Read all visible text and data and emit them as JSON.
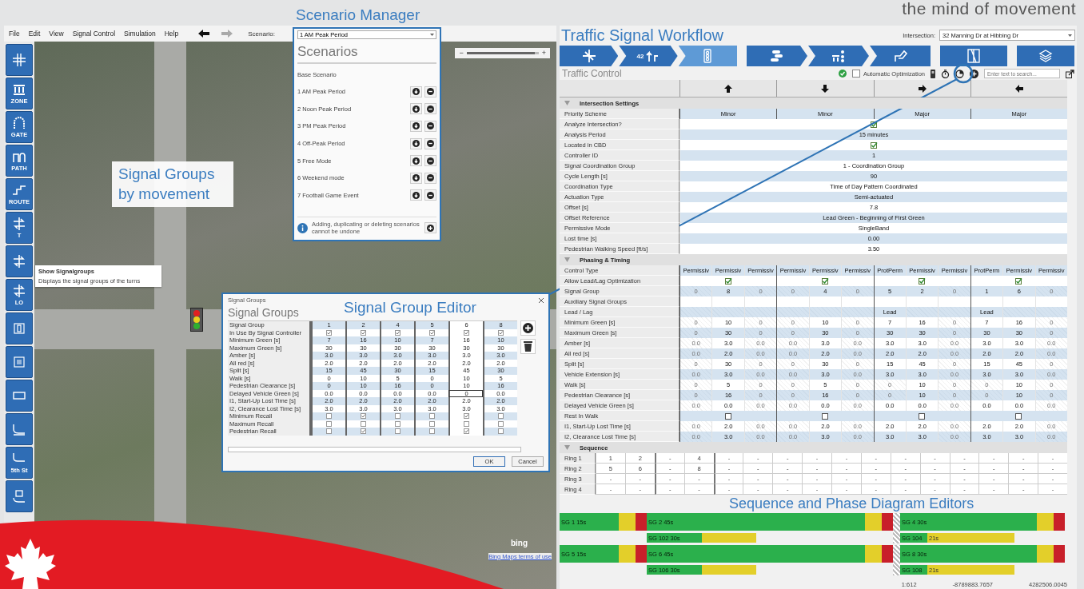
{
  "header": {
    "tagline": "the mind of movement"
  },
  "callouts": {
    "scenario_manager": "Scenario Manager",
    "workflow": "Traffic Signal Workflow",
    "signal_groups": "Signal Groups by movement",
    "editor": "Signal Group Editor",
    "sequence": "Sequence and Phase Diagram Editors"
  },
  "menu": {
    "items": [
      "File",
      "Edit",
      "View",
      "Signal Control",
      "Simulation",
      "Help"
    ],
    "nav": [
      {
        "kind": "back",
        "disabled": false
      },
      {
        "kind": "forward",
        "disabled": true
      }
    ],
    "scenario_label": "Scenario:"
  },
  "toolbar": {
    "buttons": [
      {
        "kind": "intersection"
      },
      {
        "kind": "zone",
        "label": "ZONE"
      },
      {
        "kind": "gate",
        "label": "GATE"
      },
      {
        "kind": "path",
        "label": "PATH"
      },
      {
        "kind": "route",
        "label": "ROUTE"
      },
      {
        "kind": "turns",
        "label": "T"
      },
      {
        "kind": "turns"
      },
      {
        "kind": "turns",
        "label": "LO"
      },
      {
        "kind": "signal"
      },
      {
        "kind": "detector"
      },
      {
        "kind": "sign"
      },
      {
        "kind": "road"
      },
      {
        "kind": "street",
        "label": "5th St"
      },
      {
        "kind": "lane"
      }
    ]
  },
  "map": {
    "zoom": {
      "out": "−",
      "in": "+",
      "level": 0.95
    },
    "tooltip": {
      "title": "Show Signalgroups",
      "text": "Displays the signal groups of the turns"
    },
    "logo": "bing",
    "attribution": "Bing Maps terms of use"
  },
  "scenarios": {
    "current": "1 AM Peak Period",
    "title": "Scenarios",
    "base": "Base Scenario",
    "items": [
      "1 AM Peak Period",
      "2 Noon Peak Period",
      "3 PM Peak Period",
      "4 Off-Peak Period",
      "5 Free Mode",
      "6 Weekend mode",
      "7 Football Game Event"
    ],
    "note": "Adding, duplicating or deleting scenarios cannot be undone"
  },
  "editor": {
    "window_title": "Signal Groups",
    "heading": "Signal Groups",
    "header_label": "Signal Group",
    "columns": [
      {
        "label": "1",
        "selected": false
      },
      {
        "label": "2",
        "selected": false
      },
      {
        "label": "4",
        "selected": false
      },
      {
        "label": "5",
        "selected": false
      },
      {
        "label": "6",
        "selected": true
      },
      {
        "label": "8",
        "selected": false
      }
    ],
    "rows": [
      {
        "label": "In Use By Signal Controller",
        "kind": "check",
        "cells": [
          {
            "checked": true
          },
          {
            "checked": true
          },
          {
            "checked": true
          },
          {
            "checked": true
          },
          {
            "checked": true
          },
          {
            "checked": true
          }
        ]
      },
      {
        "label": "Minimum Green [s]",
        "kind": "text",
        "cells": [
          "7",
          "16",
          "10",
          "7",
          "16",
          "10"
        ]
      },
      {
        "label": "Maximum Green [s]",
        "kind": "text",
        "cells": [
          "30",
          "30",
          "30",
          "30",
          "30",
          "30"
        ]
      },
      {
        "label": "Amber [s]",
        "kind": "text",
        "cells": [
          "3.0",
          "3.0",
          "3.0",
          "3.0",
          "3.0",
          "3.0"
        ]
      },
      {
        "label": "All red [s]",
        "kind": "text",
        "cells": [
          "2.0",
          "2.0",
          "2.0",
          "2.0",
          "2.0",
          "2.0"
        ]
      },
      {
        "label": "Split [s]",
        "kind": "text",
        "cells": [
          "15",
          "45",
          "30",
          "15",
          "45",
          "30"
        ]
      },
      {
        "label": "Walk [s]",
        "kind": "text",
        "cells": [
          "0",
          "10",
          "5",
          "0",
          "10",
          "5"
        ]
      },
      {
        "label": "Pedestrian Clearance [s]",
        "kind": "text",
        "cells": [
          "0",
          "10",
          "16",
          "0",
          "10",
          "16"
        ]
      },
      {
        "label": "Delayed Vehicle Green [s]",
        "kind": "edit",
        "cells": [
          {
            "text": "0.0",
            "editing": false
          },
          {
            "text": "0.0",
            "editing": false
          },
          {
            "text": "0.0",
            "editing": false
          },
          {
            "text": "0.0",
            "editing": false
          },
          {
            "text": "0",
            "editing": true
          },
          {
            "text": "0.0",
            "editing": false
          }
        ]
      },
      {
        "label": "I1, Start-Up Lost Time [s]",
        "kind": "text",
        "cells": [
          "2.0",
          "2.0",
          "2.0",
          "2.0",
          "2.0",
          "2.0"
        ]
      },
      {
        "label": "I2, Clearance Lost Time [s]",
        "kind": "text",
        "cells": [
          "3.0",
          "3.0",
          "3.0",
          "3.0",
          "3.0",
          "3.0"
        ]
      },
      {
        "label": "Minimum Recall",
        "kind": "check",
        "cells": [
          {
            "checked": false
          },
          {
            "checked": true
          },
          {
            "checked": false
          },
          {
            "checked": false
          },
          {
            "checked": true
          },
          {
            "checked": false
          }
        ]
      },
      {
        "label": "Maximum Recall",
        "kind": "check",
        "cells": [
          {
            "checked": false
          },
          {
            "checked": false
          },
          {
            "checked": false
          },
          {
            "checked": false
          },
          {
            "checked": false
          },
          {
            "checked": false
          }
        ]
      },
      {
        "label": "Pedestrian Recall",
        "kind": "check",
        "cells": [
          {
            "checked": false
          },
          {
            "checked": true
          },
          {
            "checked": false
          },
          {
            "checked": false
          },
          {
            "checked": true
          },
          {
            "checked": false
          }
        ]
      }
    ],
    "buttons": [
      {
        "label": "OK",
        "default": true
      },
      {
        "label": "Cancel",
        "default": false
      }
    ]
  },
  "workflow": {
    "intersection_label": "Intersection:",
    "intersection": "32 Manning Dr at Hibbing Dr",
    "groups": [
      {
        "steps": [
          {
            "kind": "network",
            "selected": false
          },
          {
            "kind": "volume",
            "label": "42",
            "selected": false
          },
          {
            "kind": "signal",
            "selected": true
          }
        ]
      },
      {
        "steps": [
          {
            "kind": "cars",
            "selected": false
          },
          {
            "kind": "zone",
            "selected": false
          },
          {
            "kind": "hand",
            "selected": false
          }
        ]
      },
      {
        "steps": [
          {
            "kind": "diagram",
            "selected": false
          }
        ]
      },
      {
        "steps": [
          {
            "kind": "layers",
            "selected": false
          }
        ]
      }
    ]
  },
  "traffic_control": {
    "title": "Traffic Control",
    "valid": true,
    "auto_optimization": {
      "label": "Automatic Optimization",
      "checked": false
    },
    "search_placeholder": "Enter text to search..."
  },
  "intersection_settings": {
    "title": "Intersection Settings",
    "expanded": true,
    "rows": [
      {
        "label": "Priority Scheme",
        "kind": "split",
        "values": [
          "Minor",
          "Minor",
          "Major",
          "Major"
        ]
      },
      {
        "label": "Analyze Intersection?",
        "kind": "check",
        "checked": true
      },
      {
        "label": "Analysis Period",
        "kind": "text",
        "value": "15 minutes"
      },
      {
        "label": "Located in CBD",
        "kind": "check",
        "checked": true
      },
      {
        "label": "Controller ID",
        "kind": "text",
        "value": "1"
      },
      {
        "label": "Signal Coordination Group",
        "kind": "text",
        "value": "1 - Coordination Group"
      },
      {
        "label": "Cycle Length [s]",
        "kind": "text",
        "value": "90"
      },
      {
        "label": "Coordination Type",
        "kind": "text",
        "value": "Time of Day Pattern Coordinated"
      },
      {
        "label": "Actuation Type",
        "kind": "text",
        "value": "Semi-actuated"
      },
      {
        "label": "Offset [s]",
        "kind": "text",
        "value": "7.8"
      },
      {
        "label": "Offset Reference",
        "kind": "text",
        "value": "Lead Green - Beginning of First Green"
      },
      {
        "label": "Permissive Mode",
        "kind": "text",
        "value": "SingleBand"
      },
      {
        "label": "Lost time [s]",
        "kind": "text",
        "value": "0.00"
      },
      {
        "label": "Pedestrian Walking Speed [ft/s]",
        "kind": "text",
        "value": "3.50"
      }
    ]
  },
  "phasing": {
    "title": "Phasing & Timing",
    "expanded": true,
    "rows": [
      {
        "label": "Control Type",
        "kind": "values",
        "cells": [
          {
            "text": "Permissiv",
            "disabled": false
          },
          {
            "text": "Permissiv",
            "disabled": false
          },
          {
            "text": "Permissiv",
            "disabled": false
          },
          {
            "text": "Permissiv",
            "disabled": false
          },
          {
            "text": "Permissiv",
            "disabled": false
          },
          {
            "text": "Permissiv",
            "disabled": false
          },
          {
            "text": "ProtPerm",
            "disabled": false
          },
          {
            "text": "Permissiv",
            "disabled": false
          },
          {
            "text": "Permissiv",
            "disabled": false
          },
          {
            "text": "ProtPerm",
            "disabled": false
          },
          {
            "text": "Permissiv",
            "disabled": false
          },
          {
            "text": "Permissiv",
            "disabled": false
          }
        ]
      },
      {
        "label": "Allow Lead/Lag Optimization",
        "kind": "check",
        "groups": [
          {
            "checked": true
          },
          {
            "checked": true
          },
          {
            "checked": true
          },
          {
            "checked": true
          }
        ]
      },
      {
        "label": "Signal Group",
        "kind": "values",
        "cells": [
          {
            "text": "0",
            "disabled": true
          },
          {
            "text": "8",
            "disabled": false
          },
          {
            "text": "0",
            "disabled": true
          },
          {
            "text": "0",
            "disabled": true
          },
          {
            "text": "4",
            "disabled": false
          },
          {
            "text": "0",
            "disabled": true
          },
          {
            "text": "5",
            "disabled": false
          },
          {
            "text": "2",
            "disabled": false
          },
          {
            "text": "0",
            "disabled": true
          },
          {
            "text": "1",
            "disabled": false
          },
          {
            "text": "6",
            "disabled": false
          },
          {
            "text": "0",
            "disabled": true
          }
        ]
      },
      {
        "label": "Auxiliary Signal Groups",
        "kind": "blank"
      },
      {
        "label": "Lead / Lag",
        "kind": "values",
        "cells": [
          {
            "disabled": true
          },
          {
            "disabled": true
          },
          {
            "disabled": true
          },
          {
            "disabled": true
          },
          {
            "disabled": true
          },
          {
            "disabled": true
          },
          {
            "text": "Lead",
            "disabled": false
          },
          {
            "disabled": true
          },
          {
            "disabled": true
          },
          {
            "text": "Lead",
            "disabled": false
          },
          {
            "disabled": true
          },
          {
            "disabled": true
          }
        ]
      },
      {
        "label": "Minimum Green [s]",
        "kind": "values",
        "cells": [
          {
            "text": "0",
            "disabled": true
          },
          {
            "text": "10",
            "disabled": false
          },
          {
            "text": "0",
            "disabled": true
          },
          {
            "text": "0",
            "disabled": true
          },
          {
            "text": "10",
            "disabled": false
          },
          {
            "text": "0",
            "disabled": true
          },
          {
            "text": "7",
            "disabled": false
          },
          {
            "text": "16",
            "disabled": false
          },
          {
            "text": "0",
            "disabled": true
          },
          {
            "text": "7",
            "disabled": false
          },
          {
            "text": "16",
            "disabled": false
          },
          {
            "text": "0",
            "disabled": true
          }
        ]
      },
      {
        "label": "Maximum Green [s]",
        "kind": "values",
        "cells": [
          {
            "text": "0",
            "disabled": true
          },
          {
            "text": "30",
            "disabled": false
          },
          {
            "text": "0",
            "disabled": true
          },
          {
            "text": "0",
            "disabled": true
          },
          {
            "text": "30",
            "disabled": false
          },
          {
            "text": "0",
            "disabled": true
          },
          {
            "text": "30",
            "disabled": false
          },
          {
            "text": "30",
            "disabled": false
          },
          {
            "text": "0",
            "disabled": true
          },
          {
            "text": "30",
            "disabled": false
          },
          {
            "text": "30",
            "disabled": false
          },
          {
            "text": "0",
            "disabled": true
          }
        ]
      },
      {
        "label": "Amber [s]",
        "kind": "values",
        "cells": [
          {
            "text": "0.0",
            "disabled": true
          },
          {
            "text": "3.0",
            "disabled": false
          },
          {
            "text": "0.0",
            "disabled": true
          },
          {
            "text": "0.0",
            "disabled": true
          },
          {
            "text": "3.0",
            "disabled": false
          },
          {
            "text": "0.0",
            "disabled": true
          },
          {
            "text": "3.0",
            "disabled": false
          },
          {
            "text": "3.0",
            "disabled": false
          },
          {
            "text": "0.0",
            "disabled": true
          },
          {
            "text": "3.0",
            "disabled": false
          },
          {
            "text": "3.0",
            "disabled": false
          },
          {
            "text": "0.0",
            "disabled": true
          }
        ]
      },
      {
        "label": "All red [s]",
        "kind": "values",
        "cells": [
          {
            "text": "0.0",
            "disabled": true
          },
          {
            "text": "2.0",
            "disabled": false
          },
          {
            "text": "0.0",
            "disabled": true
          },
          {
            "text": "0.0",
            "disabled": true
          },
          {
            "text": "2.0",
            "disabled": false
          },
          {
            "text": "0.0",
            "disabled": true
          },
          {
            "text": "2.0",
            "disabled": false
          },
          {
            "text": "2.0",
            "disabled": false
          },
          {
            "text": "0.0",
            "disabled": true
          },
          {
            "text": "2.0",
            "disabled": false
          },
          {
            "text": "2.0",
            "disabled": false
          },
          {
            "text": "0.0",
            "disabled": true
          }
        ]
      },
      {
        "label": "Split [s]",
        "kind": "values",
        "cells": [
          {
            "text": "0",
            "disabled": true
          },
          {
            "text": "30",
            "disabled": false
          },
          {
            "text": "0",
            "disabled": true
          },
          {
            "text": "0",
            "disabled": true
          },
          {
            "text": "30",
            "disabled": false
          },
          {
            "text": "0",
            "disabled": true
          },
          {
            "text": "15",
            "disabled": false
          },
          {
            "text": "45",
            "disabled": false
          },
          {
            "text": "0",
            "disabled": true
          },
          {
            "text": "15",
            "disabled": false
          },
          {
            "text": "45",
            "disabled": false
          },
          {
            "text": "0",
            "disabled": true
          }
        ]
      },
      {
        "label": "Vehicle Extension [s]",
        "kind": "values",
        "cells": [
          {
            "text": "0.0",
            "disabled": true
          },
          {
            "text": "3.0",
            "disabled": false
          },
          {
            "text": "0.0",
            "disabled": true
          },
          {
            "text": "0.0",
            "disabled": true
          },
          {
            "text": "3.0",
            "disabled": false
          },
          {
            "text": "0.0",
            "disabled": true
          },
          {
            "text": "3.0",
            "disabled": false
          },
          {
            "text": "3.0",
            "disabled": false
          },
          {
            "text": "0.0",
            "disabled": true
          },
          {
            "text": "3.0",
            "disabled": false
          },
          {
            "text": "3.0",
            "disabled": false
          },
          {
            "text": "0.0",
            "disabled": true
          }
        ]
      },
      {
        "label": "Walk [s]",
        "kind": "values",
        "cells": [
          {
            "text": "0",
            "disabled": true
          },
          {
            "text": "5",
            "disabled": false
          },
          {
            "text": "0",
            "disabled": true
          },
          {
            "text": "0",
            "disabled": true
          },
          {
            "text": "5",
            "disabled": false
          },
          {
            "text": "0",
            "disabled": true
          },
          {
            "text": "0",
            "disabled": true
          },
          {
            "text": "10",
            "disabled": false
          },
          {
            "text": "0",
            "disabled": true
          },
          {
            "text": "0",
            "disabled": true
          },
          {
            "text": "10",
            "disabled": false
          },
          {
            "text": "0",
            "disabled": true
          }
        ]
      },
      {
        "label": "Pedestrian Clearance [s]",
        "kind": "values",
        "cells": [
          {
            "text": "0",
            "disabled": true
          },
          {
            "text": "16",
            "disabled": false
          },
          {
            "text": "0",
            "disabled": true
          },
          {
            "text": "0",
            "disabled": true
          },
          {
            "text": "16",
            "disabled": false
          },
          {
            "text": "0",
            "disabled": true
          },
          {
            "text": "0",
            "disabled": true
          },
          {
            "text": "10",
            "disabled": false
          },
          {
            "text": "0",
            "disabled": true
          },
          {
            "text": "0",
            "disabled": true
          },
          {
            "text": "10",
            "disabled": false
          },
          {
            "text": "0",
            "disabled": true
          }
        ]
      },
      {
        "label": "Delayed Vehicle Green [s]",
        "kind": "values",
        "cells": [
          {
            "text": "0.0",
            "disabled": true
          },
          {
            "text": "0.0",
            "disabled": false
          },
          {
            "text": "0.0",
            "disabled": true
          },
          {
            "text": "0.0",
            "disabled": true
          },
          {
            "text": "0.0",
            "disabled": false
          },
          {
            "text": "0.0",
            "disabled": true
          },
          {
            "text": "0.0",
            "disabled": false
          },
          {
            "text": "0.0",
            "disabled": false
          },
          {
            "text": "0.0",
            "disabled": true
          },
          {
            "text": "0.0",
            "disabled": false
          },
          {
            "text": "0.0",
            "disabled": false
          },
          {
            "text": "0.0",
            "disabled": true
          }
        ]
      },
      {
        "label": "Rest In Walk",
        "kind": "check",
        "groups": [
          {
            "checked": false
          },
          {
            "checked": false
          },
          {
            "checked": false
          },
          {
            "checked": false
          }
        ]
      },
      {
        "label": "I1, Start-Up Lost Time [s]",
        "kind": "values",
        "cells": [
          {
            "text": "0.0",
            "disabled": true
          },
          {
            "text": "2.0",
            "disabled": false
          },
          {
            "text": "0.0",
            "disabled": true
          },
          {
            "text": "0.0",
            "disabled": true
          },
          {
            "text": "2.0",
            "disabled": false
          },
          {
            "text": "0.0",
            "disabled": true
          },
          {
            "text": "2.0",
            "disabled": false
          },
          {
            "text": "2.0",
            "disabled": false
          },
          {
            "text": "0.0",
            "disabled": true
          },
          {
            "text": "2.0",
            "disabled": false
          },
          {
            "text": "2.0",
            "disabled": false
          },
          {
            "text": "0.0",
            "disabled": true
          }
        ]
      },
      {
        "label": "I2, Clearance Lost Time [s]",
        "kind": "values",
        "cells": [
          {
            "text": "0.0",
            "disabled": true
          },
          {
            "text": "3.0",
            "disabled": false
          },
          {
            "text": "0.0",
            "disabled": true
          },
          {
            "text": "0.0",
            "disabled": true
          },
          {
            "text": "3.0",
            "disabled": false
          },
          {
            "text": "0.0",
            "disabled": true
          },
          {
            "text": "3.0",
            "disabled": false
          },
          {
            "text": "3.0",
            "disabled": false
          },
          {
            "text": "0.0",
            "disabled": true
          },
          {
            "text": "3.0",
            "disabled": false
          },
          {
            "text": "3.0",
            "disabled": false
          },
          {
            "text": "0.0",
            "disabled": true
          }
        ]
      }
    ]
  },
  "sequence": {
    "title": "Sequence",
    "expanded": true,
    "rings": [
      {
        "label": "Ring 1",
        "cells": [
          "1",
          "2",
          "-",
          "4",
          "-",
          "-",
          "-",
          "-",
          "-",
          "-",
          "-",
          "-",
          "-",
          "-",
          "-",
          "-"
        ]
      },
      {
        "label": "Ring 2",
        "cells": [
          "5",
          "6",
          "-",
          "8",
          "-",
          "-",
          "-",
          "-",
          "-",
          "-",
          "-",
          "-",
          "-",
          "-",
          "-",
          "-"
        ]
      },
      {
        "label": "Ring 3",
        "cells": [
          "-",
          "-",
          "-",
          "-",
          "-",
          "-",
          "-",
          "-",
          "-",
          "-",
          "-",
          "-",
          "-",
          "-",
          "-",
          "-"
        ]
      },
      {
        "label": "Ring 4",
        "cells": [
          "-",
          "-",
          "-",
          "-",
          "-",
          "-",
          "-",
          "-",
          "-",
          "-",
          "-",
          "-",
          "-",
          "-",
          "-",
          "-"
        ]
      }
    ]
  },
  "phase_diagram": {
    "rings": [
      {
        "sections": [
          {
            "phases": [
              {
                "label": "SG 1",
                "time": "15s"
              },
              {
                "label": "SG 2",
                "time": "45s"
              }
            ],
            "overlap": {
              "label": "SG 102",
              "time": "30s"
            }
          },
          {
            "phases": [
              {
                "label": "SG 4",
                "time": "30s"
              }
            ],
            "overlap": {
              "label": "SG 104",
              "time": "21s"
            }
          }
        ]
      },
      {
        "sections": [
          {
            "phases": [
              {
                "label": "SG 5",
                "time": "15s"
              },
              {
                "label": "SG 6",
                "time": "45s"
              }
            ],
            "overlap": {
              "label": "SG 106",
              "time": "30s"
            }
          },
          {
            "phases": [
              {
                "label": "SG 8",
                "time": "30s"
              }
            ],
            "overlap": {
              "label": "SG 108",
              "time": "21s"
            }
          }
        ]
      }
    ]
  },
  "status_bar": [
    "1:612",
    "-8789883.7657",
    "4282506.0045"
  ]
}
